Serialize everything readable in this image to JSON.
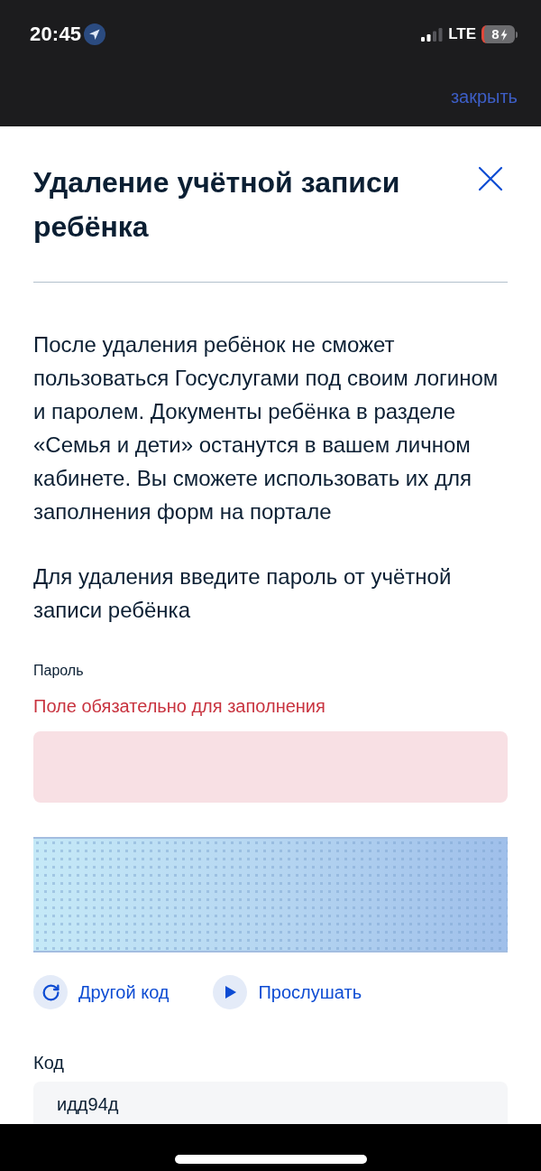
{
  "status_bar": {
    "time": "20:45",
    "network": "LTE",
    "battery": "8"
  },
  "top_bar": {
    "close_link": "закрыть"
  },
  "dialog": {
    "title": "Удаление учётной записи ребёнка",
    "description": "После удаления ребёнок не сможет пользоваться Госуслугами под своим логином и паролем. Документы ребёнка в разделе «Семья и дети» останутся в вашем личном кабинете. Вы сможете использовать их для заполнения форм на портале",
    "instruction": "Для удаления введите пароль от учётной записи ребёнка",
    "password_field": {
      "label": "Пароль",
      "error": "Поле обязательно для заполнения",
      "invalid": true
    },
    "captcha": {
      "actions": [
        {
          "kind": "refresh",
          "label": "Другой код"
        },
        {
          "kind": "listen",
          "label": "Прослушать"
        }
      ]
    },
    "code_field": {
      "label": "Код",
      "value": "идд94д"
    }
  }
}
